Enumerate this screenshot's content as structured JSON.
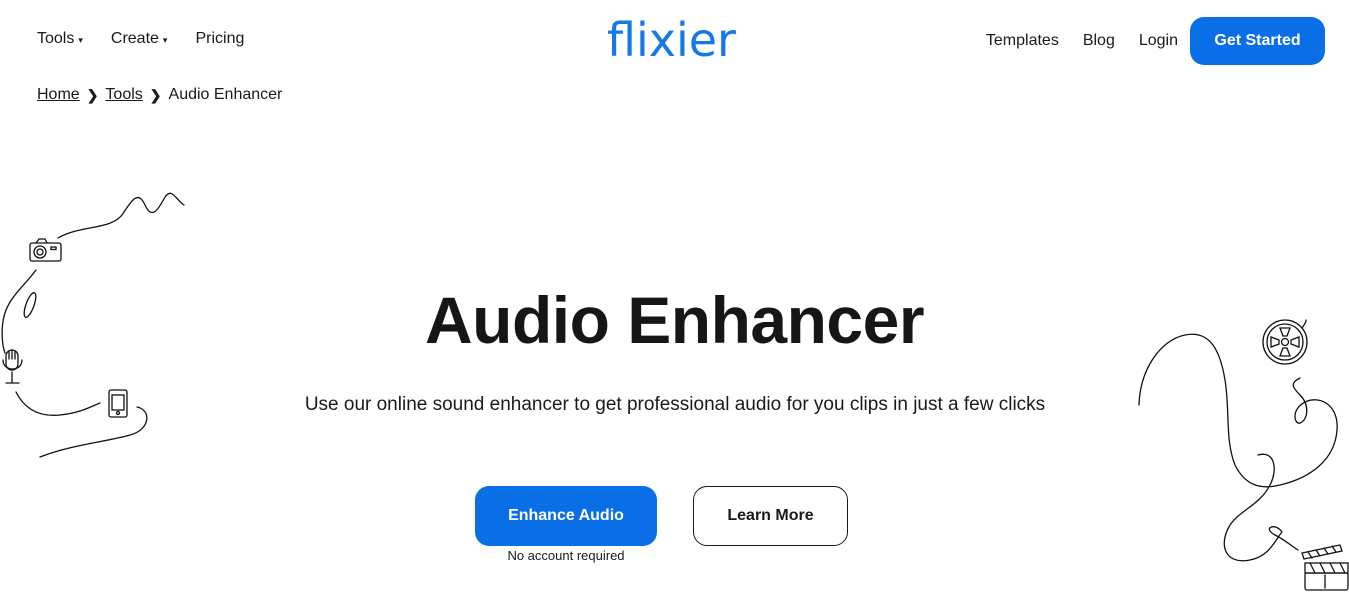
{
  "header": {
    "nav_left": [
      {
        "label": "Tools",
        "has_dropdown": true
      },
      {
        "label": "Create",
        "has_dropdown": true
      },
      {
        "label": "Pricing",
        "has_dropdown": false
      }
    ],
    "logo": "flixier",
    "nav_right": [
      {
        "label": "Templates"
      },
      {
        "label": "Blog"
      },
      {
        "label": "Login"
      }
    ],
    "cta_label": "Get Started",
    "caret_icon": "▾",
    "brand_color": "#0a6fe6"
  },
  "breadcrumb": {
    "items": [
      {
        "label": "Home",
        "link": true
      },
      {
        "label": "Tools",
        "link": true
      },
      {
        "label": "Audio Enhancer",
        "link": false
      }
    ],
    "separator": "❯"
  },
  "hero": {
    "title": "Audio Enhancer",
    "subtitle": "Use our online sound enhancer to get professional audio for you clips in just a few clicks",
    "primary_button": "Enhance Audio",
    "primary_note": "No account required",
    "secondary_button": "Learn More"
  },
  "decorations": {
    "left": [
      "camera-icon",
      "microphone-icon",
      "phone-icon"
    ],
    "right": [
      "film-reel-icon",
      "clapperboard-icon"
    ]
  }
}
